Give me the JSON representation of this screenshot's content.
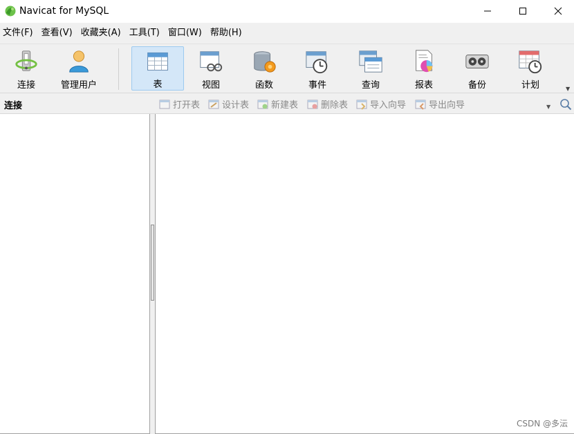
{
  "window": {
    "title": "Navicat for MySQL"
  },
  "menu": {
    "items": [
      "文件(F)",
      "查看(V)",
      "收藏夹(A)",
      "工具(T)",
      "窗口(W)",
      "帮助(H)"
    ]
  },
  "toolbar": {
    "items": [
      {
        "label": "连接",
        "icon": "connection-icon"
      },
      {
        "label": "管理用户",
        "icon": "user-icon"
      },
      {
        "label": "表",
        "icon": "table-icon",
        "active": true
      },
      {
        "label": "视图",
        "icon": "view-icon"
      },
      {
        "label": "函数",
        "icon": "function-icon"
      },
      {
        "label": "事件",
        "icon": "event-icon"
      },
      {
        "label": "查询",
        "icon": "query-icon"
      },
      {
        "label": "报表",
        "icon": "report-icon"
      },
      {
        "label": "备份",
        "icon": "backup-icon"
      },
      {
        "label": "计划",
        "icon": "schedule-icon"
      }
    ]
  },
  "subbar": {
    "connection_label": "连接",
    "actions": [
      {
        "label": "打开表",
        "enabled": false
      },
      {
        "label": "设计表",
        "enabled": false
      },
      {
        "label": "新建表",
        "enabled": false
      },
      {
        "label": "删除表",
        "enabled": false
      },
      {
        "label": "导入向导",
        "enabled": false
      },
      {
        "label": "导出向导",
        "enabled": false
      }
    ]
  },
  "watermark": "CSDN @多沄",
  "colors": {
    "toolbar_bg": "#f0f0f0",
    "active_tool_bg": "#d4e7f8",
    "disabled_text": "#8a8a8a"
  }
}
